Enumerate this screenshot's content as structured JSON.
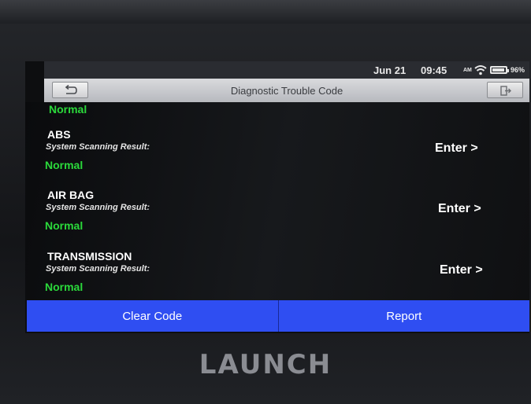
{
  "status_bar": {
    "date": "Jun 21",
    "time": "09:45",
    "ampm": "AM",
    "battery": "96%",
    "battery_level": 0.96,
    "icons": [
      "wifi-icon",
      "battery-icon"
    ]
  },
  "header": {
    "title": "Diagnostic Trouble Code",
    "icons": [
      "back-arrow-icon",
      "exit-icon"
    ]
  },
  "list": {
    "partial_status": "Normal",
    "systems": [
      {
        "name": "ABS",
        "label": "System Scanning Result:",
        "status": "Normal",
        "action": "Enter >"
      },
      {
        "name": "AIR BAG",
        "label": "System Scanning Result:",
        "status": "Normal",
        "action": "Enter >"
      },
      {
        "name": "TRANSMISSION",
        "label": "System Scanning Result:",
        "status": "Normal",
        "action": "Enter >"
      }
    ]
  },
  "footer": {
    "clear_code": "Clear Code",
    "report": "Report"
  },
  "device": {
    "brand": "LAUNCH"
  },
  "colors": {
    "accent": "#2f4ef2",
    "status_ok": "#2bd93b"
  }
}
